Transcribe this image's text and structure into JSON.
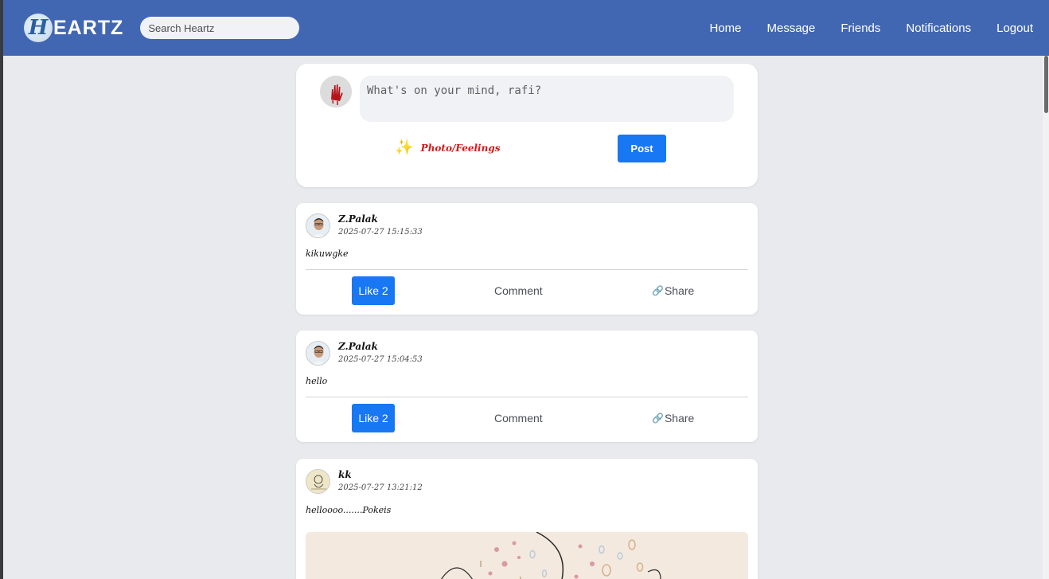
{
  "brand": {
    "logo_letter": "H",
    "name": "EARTZ"
  },
  "search": {
    "placeholder": "Search Heartz"
  },
  "nav": {
    "items": [
      "Home",
      "Message",
      "Friends",
      "Notifications",
      "Logout"
    ]
  },
  "composer": {
    "placeholder": "What's on your mind, rafi?",
    "photo_label": "Photo/Feelings",
    "sparkle_icon": "✨",
    "post_label": "Post"
  },
  "posts": [
    {
      "author": "Z.Palak",
      "time": "2025-07-27 15:15:33",
      "text": "kikuwgke",
      "like_label": "Like 2",
      "comment_label": "Comment",
      "share_label": "Share"
    },
    {
      "author": "Z.Palak",
      "time": "2025-07-27 15:04:53",
      "text": "hello",
      "like_label": "Like 2",
      "comment_label": "Comment",
      "share_label": "Share"
    },
    {
      "author": "kk",
      "time": "2025-07-27 13:21:12",
      "text": "helloooo.......Pokeis"
    }
  ],
  "icons": {
    "link_icon": "🔗"
  },
  "colors": {
    "navbar": "#4267b2",
    "primary_button": "#1877f2",
    "page_bg": "#e9eaee",
    "photo_label": "#d21a1a"
  }
}
